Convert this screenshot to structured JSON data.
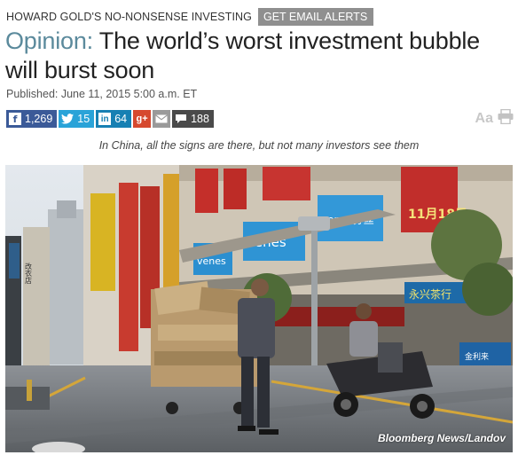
{
  "column": {
    "kicker": "HOWARD GOLD'S NO-NONSENSE INVESTING",
    "alert_button": "GET EMAIL ALERTS"
  },
  "headline": {
    "section": "Opinion:",
    "title": "The world’s worst investment bubble will burst soon"
  },
  "published": "Published: June 11, 2015 5:00 a.m. ET",
  "share": {
    "facebook": "1,269",
    "twitter": "15",
    "linkedin": "64",
    "comments": "188"
  },
  "tools": {
    "font_size_label": "Aa"
  },
  "subhead": "In China, all the signs are there, but not many investors see them",
  "photo": {
    "credit": "Bloomberg News/Landov",
    "signs": {
      "left_sign": "改衣店",
      "date_sign": "11月18日",
      "venes_1": "venes",
      "venes_2": "venes",
      "venes_3": "venes芬丝",
      "shop_sign": "永兴茶行",
      "street_sign": "金利来"
    }
  },
  "colors": {
    "section_accent": "#5b8a9c",
    "facebook": "#3b5a98",
    "twitter": "#2aa3d8",
    "linkedin": "#1780b3",
    "google_plus": "#d6492f",
    "email": "#9a9a9a",
    "comments": "#4a4a4a"
  }
}
